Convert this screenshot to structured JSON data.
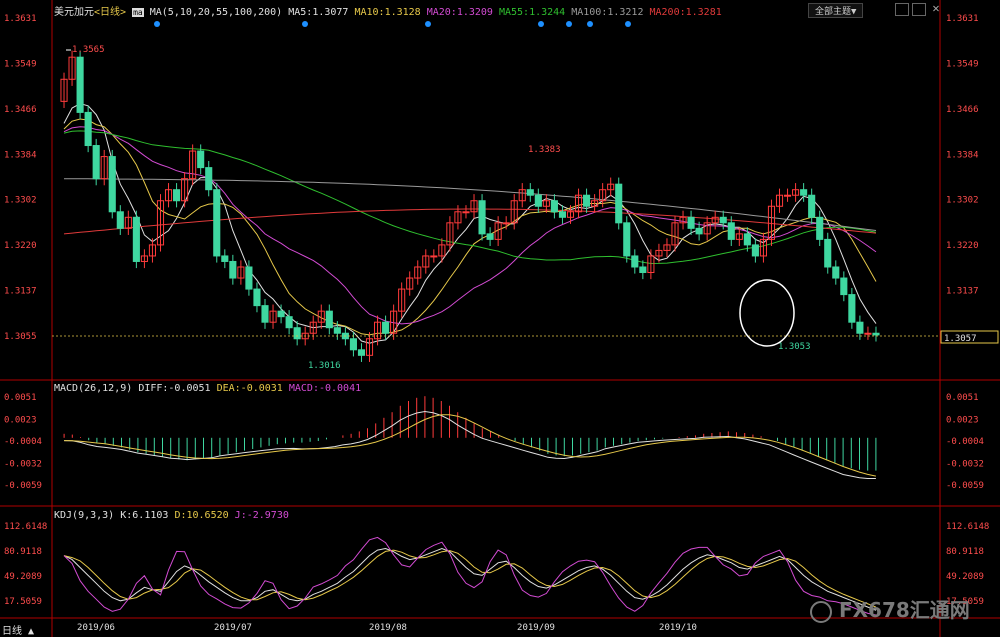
{
  "window": {
    "title": "美元加元",
    "period": "<日线>",
    "theme_label": "全部主题▼"
  },
  "ma_header": {
    "params": "MA(5,10,20,55,100,200)",
    "items": [
      {
        "label": "MA5:1.3077",
        "color": "#e0e0e0"
      },
      {
        "label": "MA10:1.3128",
        "color": "#e6c84a"
      },
      {
        "label": "MA20:1.3209",
        "color": "#d24bd2"
      },
      {
        "label": "MA55:1.3244",
        "color": "#2fbf2f"
      },
      {
        "label": "MA100:1.3212",
        "color": "#9a9a9a"
      },
      {
        "label": "MA200:1.3281",
        "color": "#e03a3a"
      }
    ]
  },
  "macd_header": {
    "params": "MACD(26,12,9)",
    "diff": "DIFF:-0.0051",
    "dea": "DEA:-0.0031",
    "macd": "MACD:-0.0041"
  },
  "kdj_header": {
    "params": "KDJ(9,3,3)",
    "k": "K:6.1103",
    "d": "D:10.6520",
    "j": "J:-2.9730"
  },
  "annotations": {
    "high": "1.3565",
    "low": "1.3016",
    "mid_high": "1.3383",
    "last_low": "1.3053",
    "current_price": "1.3057",
    "right_current": "1.3057",
    "right_dash": "1.3055"
  },
  "bottom": {
    "tab": "日线 ▲",
    "watermark_brand": "FX678",
    "watermark_cn": "汇通网"
  },
  "colors": {
    "up": "#ff3b3b",
    "down": "#3fd7a0",
    "axis": "#b00000",
    "label": "#ff4d4d"
  },
  "chart_data": [
    {
      "type": "candlestick",
      "title": "美元加元 日线",
      "ylim": [
        1.3016,
        1.3631
      ],
      "y_ticks": [
        "1.3631",
        "1.3549",
        "1.3466",
        "1.3384",
        "1.3302",
        "1.3220",
        "1.3137",
        "1.3055"
      ],
      "x_ticks": [
        "2019/06",
        "2019/07",
        "2019/08",
        "2019/09",
        "2019/10"
      ],
      "close": [
        1.352,
        1.356,
        1.346,
        1.34,
        1.334,
        1.338,
        1.328,
        1.325,
        1.327,
        1.319,
        1.32,
        1.322,
        1.33,
        1.332,
        1.33,
        1.334,
        1.339,
        1.336,
        1.332,
        1.32,
        1.319,
        1.316,
        1.318,
        1.314,
        1.311,
        1.308,
        1.31,
        1.309,
        1.307,
        1.305,
        1.306,
        1.308,
        1.31,
        1.307,
        1.306,
        1.305,
        1.303,
        1.302,
        1.305,
        1.308,
        1.306,
        1.31,
        1.314,
        1.316,
        1.318,
        1.32,
        1.32,
        1.322,
        1.326,
        1.328,
        1.328,
        1.33,
        1.324,
        1.323,
        1.326,
        1.326,
        1.33,
        1.332,
        1.331,
        1.329,
        1.33,
        1.328,
        1.327,
        1.328,
        1.331,
        1.329,
        1.33,
        1.332,
        1.333,
        1.326,
        1.32,
        1.318,
        1.317,
        1.32,
        1.321,
        1.322,
        1.326,
        1.327,
        1.325,
        1.324,
        1.326,
        1.327,
        1.326,
        1.323,
        1.324,
        1.322,
        1.32,
        1.323,
        1.329,
        1.331,
        1.331,
        1.332,
        1.331,
        1.327,
        1.323,
        1.318,
        1.316,
        1.313,
        1.308,
        1.306,
        1.306,
        1.3057
      ],
      "ma5_tail": "1.3077",
      "ma200": "1.3281"
    },
    {
      "type": "bar",
      "title": "MACD(26,12,9)",
      "y_ticks": [
        "0.0051",
        "0.0023",
        "-0.0004",
        "-0.0032",
        "-0.0059"
      ],
      "ylim": [
        -0.0078,
        0.0062
      ],
      "macd": [
        0.0005,
        0.0004,
        0.0001,
        -0.0003,
        -0.0006,
        -0.0008,
        -0.001,
        -0.0012,
        -0.0015,
        -0.0018,
        -0.002,
        -0.0022,
        -0.0024,
        -0.0026,
        -0.0027,
        -0.0028,
        -0.0027,
        -0.0026,
        -0.0025,
        -0.0022,
        -0.002,
        -0.0018,
        -0.0016,
        -0.0014,
        -0.0012,
        -0.001,
        -0.0008,
        -0.0007,
        -0.0006,
        -0.0006,
        -0.0005,
        -0.0004,
        -0.0002,
        0.0,
        0.0003,
        0.0005,
        0.0008,
        0.0012,
        0.0018,
        0.0025,
        0.0032,
        0.004,
        0.0046,
        0.005,
        0.0052,
        0.005,
        0.0046,
        0.004,
        0.0032,
        0.0025,
        0.0018,
        0.0012,
        0.0008,
        0.0004,
        0.0,
        -0.0004,
        -0.0008,
        -0.0012,
        -0.0016,
        -0.002,
        -0.0022,
        -0.0023,
        -0.0022,
        -0.002,
        -0.0018,
        -0.0016,
        -0.0012,
        -0.001,
        -0.0008,
        -0.0006,
        -0.0004,
        -0.0003,
        -0.0002,
        -0.0001,
        0.0,
        0.0001,
        0.0002,
        0.0003,
        0.0005,
        0.0006,
        0.0007,
        0.0008,
        0.0007,
        0.0006,
        0.0004,
        0.0002,
        0.0,
        -0.0004,
        -0.0008,
        -0.0012,
        -0.0016,
        -0.002,
        -0.0024,
        -0.0028,
        -0.0032,
        -0.0036,
        -0.0038,
        -0.004,
        -0.0041,
        -0.0041
      ]
    },
    {
      "type": "line",
      "title": "KDJ(9,3,3)",
      "y_ticks": [
        "112.6148",
        "80.9118",
        "49.2089",
        "17.5059"
      ],
      "ylim": [
        0,
        120
      ],
      "k": [
        75,
        70,
        60,
        50,
        40,
        30,
        22,
        18,
        20,
        28,
        35,
        32,
        30,
        42,
        55,
        62,
        58,
        50,
        42,
        35,
        28,
        22,
        18,
        18,
        22,
        30,
        32,
        26,
        20,
        18,
        20,
        26,
        30,
        35,
        40,
        48,
        55,
        65,
        75,
        82,
        84,
        80,
        74,
        70,
        72,
        76,
        80,
        84,
        80,
        70,
        60,
        52,
        50,
        58,
        66,
        68,
        60,
        50,
        42,
        36,
        34,
        38,
        44,
        50,
        56,
        60,
        62,
        58,
        50,
        40,
        30,
        22,
        20,
        24,
        30,
        38,
        48,
        58,
        66,
        72,
        76,
        74,
        70,
        66,
        60,
        58,
        62,
        66,
        70,
        74,
        70,
        60,
        50,
        42,
        36,
        30,
        26,
        22,
        18,
        14,
        10,
        6
      ]
    }
  ]
}
